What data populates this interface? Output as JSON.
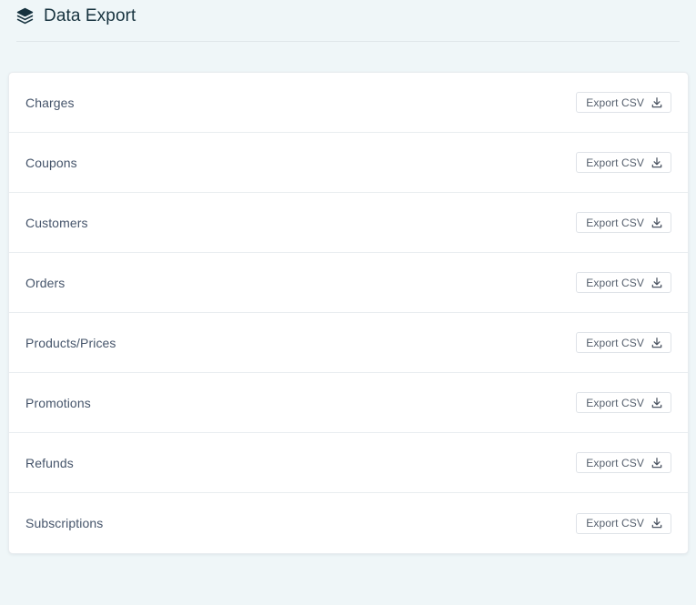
{
  "header": {
    "icon": "layers-icon",
    "title": "Data Export"
  },
  "export_list": {
    "button_label": "Export CSV",
    "button_icon": "download-icon",
    "rows": [
      {
        "label": "Charges",
        "button_label": "Export CSV"
      },
      {
        "label": "Coupons",
        "button_label": "Export CSV"
      },
      {
        "label": "Customers",
        "button_label": "Export CSV"
      },
      {
        "label": "Orders",
        "button_label": "Export CSV"
      },
      {
        "label": "Products/Prices",
        "button_label": "Export CSV"
      },
      {
        "label": "Promotions",
        "button_label": "Export CSV"
      },
      {
        "label": "Refunds",
        "button_label": "Export CSV"
      },
      {
        "label": "Subscriptions",
        "button_label": "Export CSV"
      }
    ]
  },
  "colors": {
    "page_background": "#eff6f8",
    "card_background": "#ffffff",
    "title_text": "#17333f",
    "row_label_text": "#46556b",
    "button_text": "#56606e",
    "border": "#e8ecef",
    "divider": "#e9edf0"
  }
}
